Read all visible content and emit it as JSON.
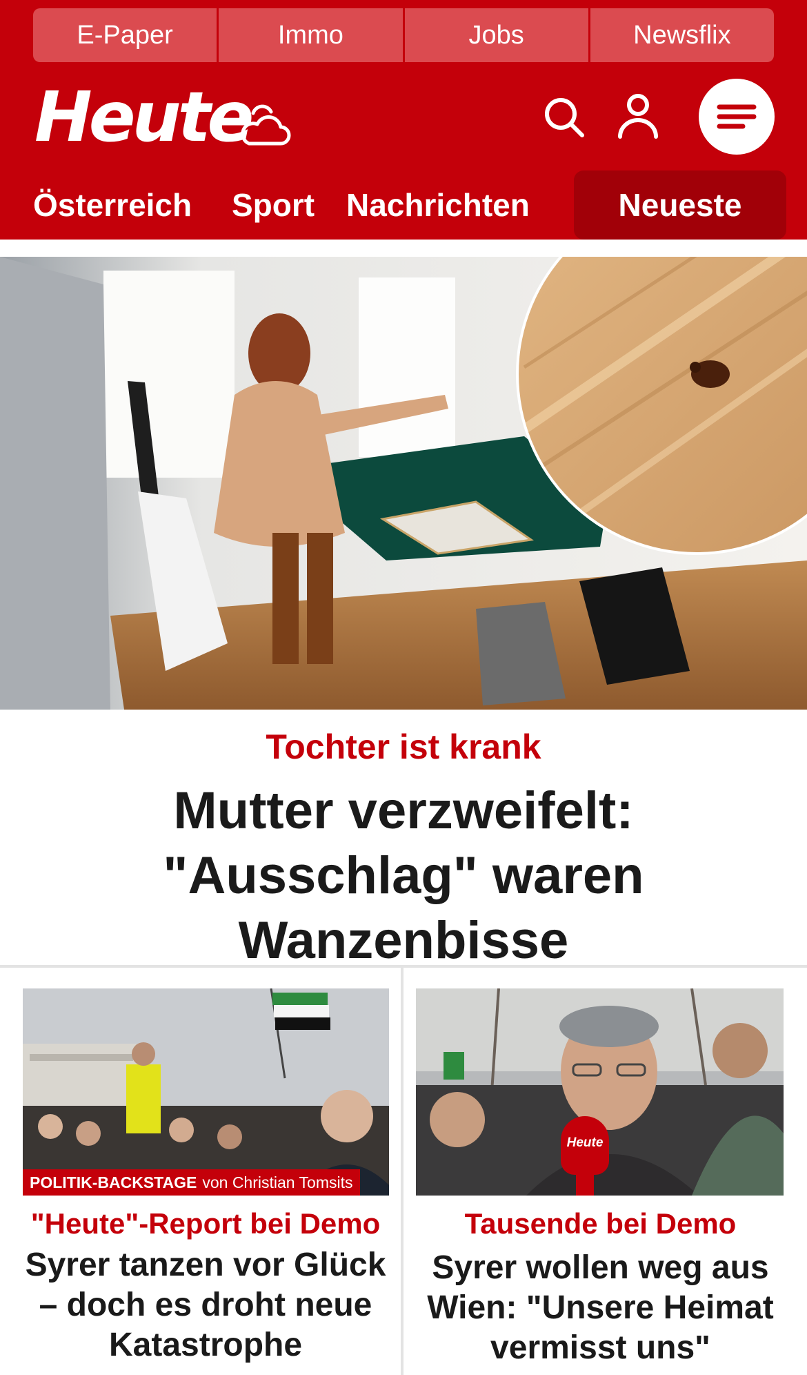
{
  "topnav": {
    "items": [
      {
        "label": "E-Paper"
      },
      {
        "label": "Immo"
      },
      {
        "label": "Jobs"
      },
      {
        "label": "Newsflix"
      }
    ]
  },
  "header": {
    "logo_text": "Heute",
    "icons": [
      "weather-cloud-icon",
      "search-icon",
      "user-icon",
      "menu-icon"
    ]
  },
  "sections": {
    "items": [
      {
        "label": "Österreich"
      },
      {
        "label": "Sport"
      },
      {
        "label": "Nachrichten"
      }
    ],
    "active_label": "Neueste"
  },
  "hero": {
    "kicker": "Tochter ist krank",
    "title": "Mutter verzweifelt: \"Ausschlag\" waren Wanzenbisse"
  },
  "teasers": [
    {
      "overlay_strong": "POLITIK-BACKSTAGE",
      "overlay_text": "von Christian Tomsits",
      "kicker": "\"Heute\"-Report bei Demo",
      "title": "Syrer tanzen vor Glück – doch es droht neue Katastrophe"
    },
    {
      "mic_label": "Heute",
      "kicker": "Tausende bei Demo",
      "title": "Syrer wollen weg aus Wien: \"Unsere Heimat vermisst uns\""
    }
  ],
  "colors": {
    "brand_red": "#c4000a",
    "topnav_bg": "#db4b50",
    "active_tab_bg": "#a10008",
    "text_dark": "#1a1a1a"
  }
}
